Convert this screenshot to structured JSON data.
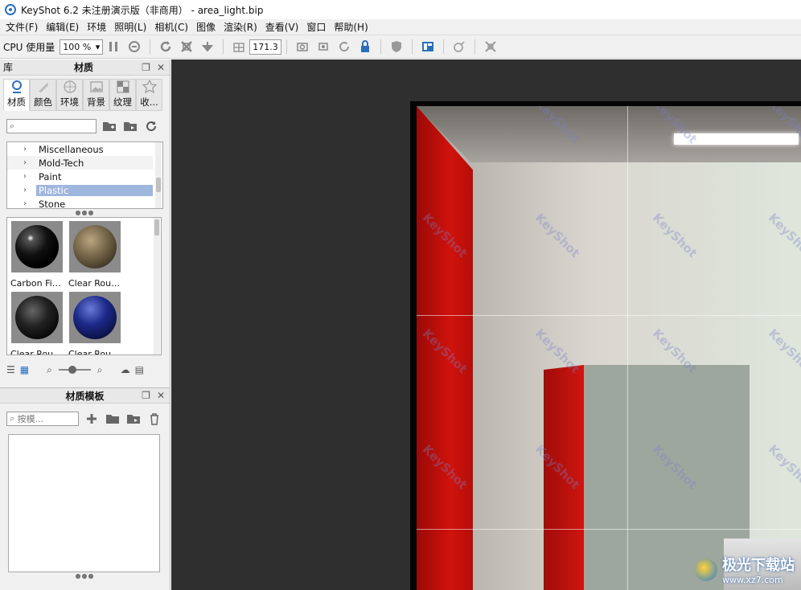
{
  "window": {
    "title": "KeyShot 6.2 未注册演示版（非商用）  - area_light.bip"
  },
  "menu": [
    "文件(F)",
    "编辑(E)",
    "环境",
    "照明(L)",
    "相机(C)",
    "图像",
    "渲染(R)",
    "查看(V)",
    "窗口",
    "帮助(H)"
  ],
  "toolbar": {
    "cpu_label": "CPU 使用量",
    "cpu_value": "100 %",
    "fov_value": "171.3"
  },
  "library": {
    "panel_title": "库",
    "section_title": "材质",
    "tabs": [
      {
        "label": "材质",
        "icon": "material-icon"
      },
      {
        "label": "颜色",
        "icon": "color-icon"
      },
      {
        "label": "环境",
        "icon": "environment-icon"
      },
      {
        "label": "背景",
        "icon": "background-icon"
      },
      {
        "label": "纹理",
        "icon": "texture-icon"
      },
      {
        "label": "收...",
        "icon": "star-icon"
      }
    ],
    "tree_items": [
      "Miscellaneous",
      "Mold-Tech",
      "Paint",
      "Plastic",
      "Stone"
    ],
    "selected_item": "Plastic",
    "thumbnails": [
      {
        "caption": "Carbon Fib..."
      },
      {
        "caption": "Clear Roug..."
      },
      {
        "caption": "Clear Roug..."
      },
      {
        "caption": "Clear Roug..."
      }
    ]
  },
  "template": {
    "title": "材质模板",
    "search_placeholder": "按模..."
  },
  "viewport": {
    "watermark_text": "KeyShot"
  },
  "site_watermark": {
    "name": "极光下载站",
    "url": "www.xz7.com"
  }
}
